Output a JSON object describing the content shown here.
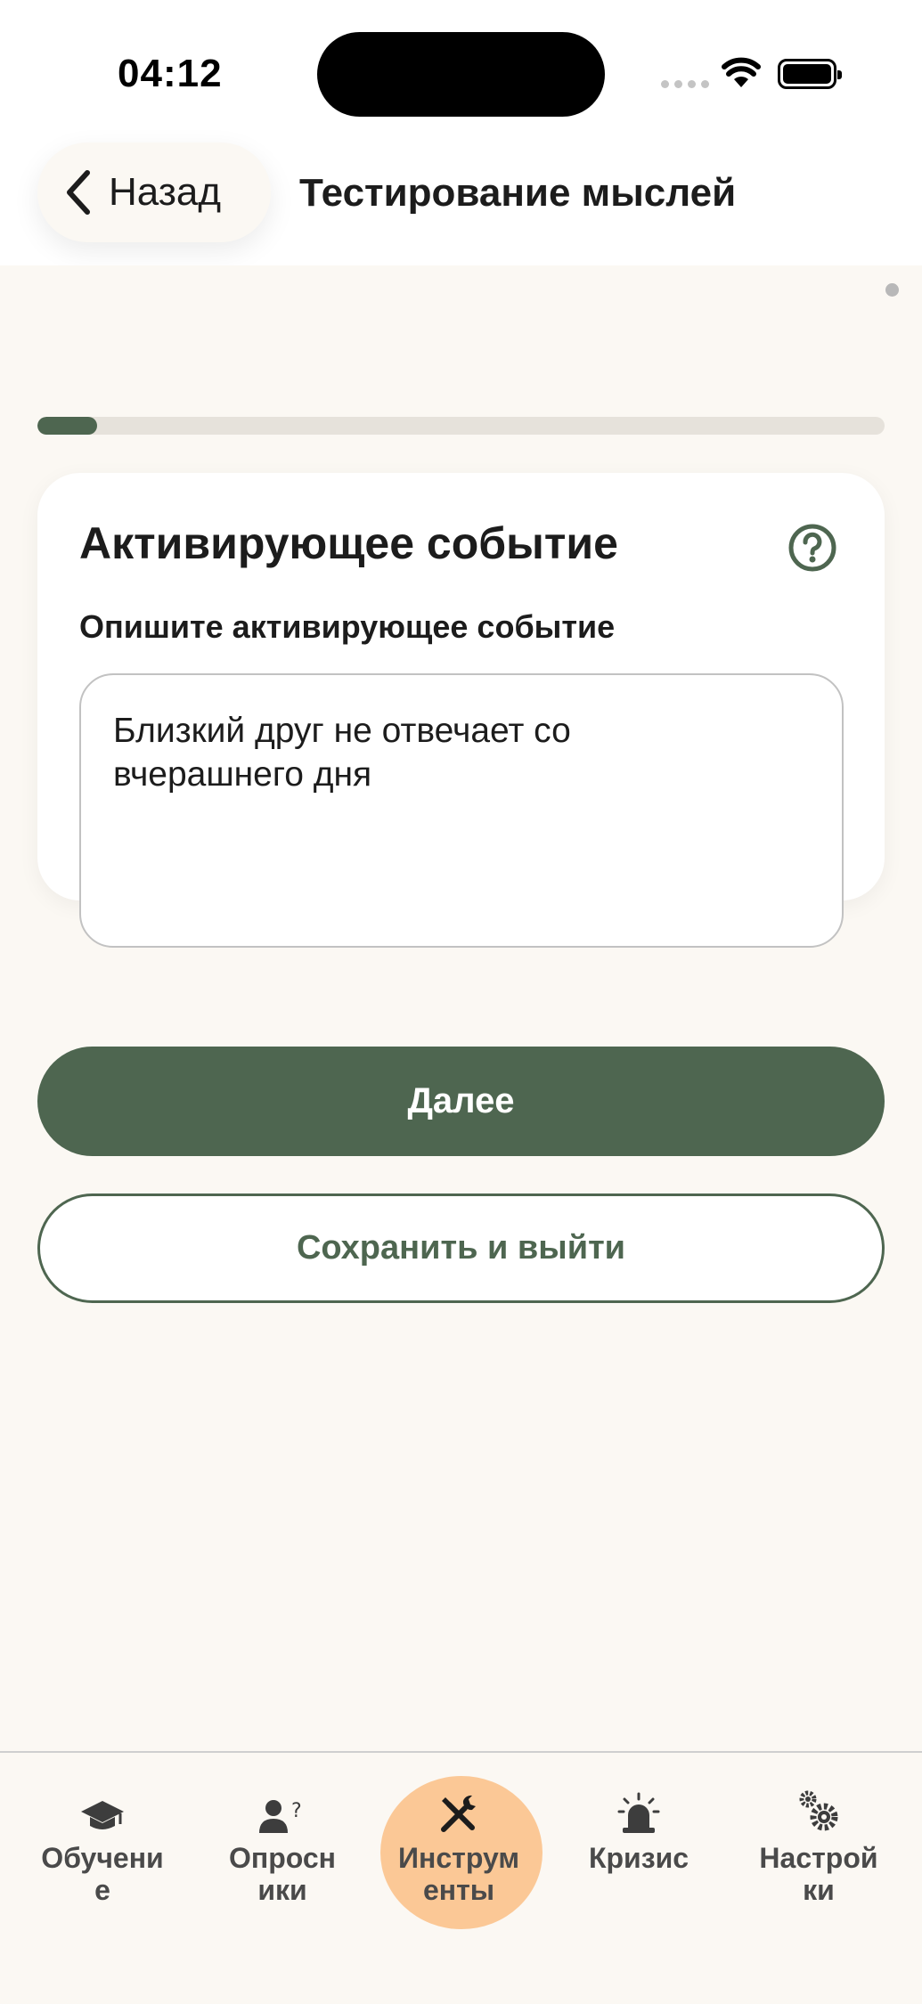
{
  "status_bar": {
    "time": "04:12"
  },
  "header": {
    "back_label": "Назад",
    "title": "Тестирование мыслей"
  },
  "progress": {
    "value_percent": 7
  },
  "card": {
    "title": "Активирующее событие",
    "field_label": "Опишите активирующее событие",
    "field_value_line1": "Близкий друг не отвечает со",
    "field_value_line2": "вчерашнего дня"
  },
  "buttons": {
    "next_label": "Далее",
    "save_exit_label": "Сохранить и выйти"
  },
  "tabs": [
    {
      "line1": "Обучени",
      "line2": "е",
      "icon": "graduation-cap-icon",
      "active": false
    },
    {
      "line1": "Опросн",
      "line2": "ики",
      "icon": "user-question-icon",
      "active": false
    },
    {
      "line1": "Инструм",
      "line2": "енты",
      "icon": "tools-icon",
      "active": true
    },
    {
      "line1": "Кризис",
      "line2": "",
      "icon": "siren-icon",
      "active": false
    },
    {
      "line1": "Настрой",
      "line2": "ки",
      "icon": "gears-icon",
      "active": false
    }
  ],
  "colors": {
    "primary": "#4e6650",
    "background": "#fbf8f3",
    "active_tab": "#fbc896"
  }
}
